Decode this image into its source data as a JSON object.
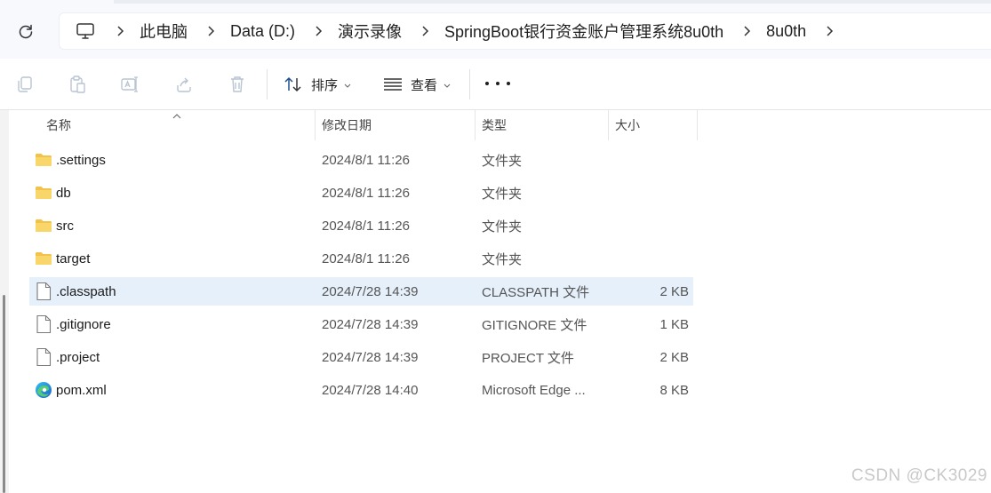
{
  "address": {
    "crumbs": [
      "此电脑",
      "Data (D:)",
      "演示录像",
      "SpringBoot银行资金账户管理系统8u0th",
      "8u0th"
    ]
  },
  "toolbar": {
    "sort_label": "排序",
    "view_label": "查看"
  },
  "columns": {
    "name": "名称",
    "date": "修改日期",
    "type": "类型",
    "size": "大小"
  },
  "files": [
    {
      "name": ".settings",
      "date": "2024/8/1 11:26",
      "type": "文件夹",
      "size": "",
      "icon": "folder-icon"
    },
    {
      "name": "db",
      "date": "2024/8/1 11:26",
      "type": "文件夹",
      "size": "",
      "icon": "folder-icon"
    },
    {
      "name": "src",
      "date": "2024/8/1 11:26",
      "type": "文件夹",
      "size": "",
      "icon": "folder-icon"
    },
    {
      "name": "target",
      "date": "2024/8/1 11:26",
      "type": "文件夹",
      "size": "",
      "icon": "folder-icon"
    },
    {
      "name": ".classpath",
      "date": "2024/7/28 14:39",
      "type": "CLASSPATH 文件",
      "size": "2 KB",
      "icon": "file-icon",
      "selected": true
    },
    {
      "name": ".gitignore",
      "date": "2024/7/28 14:39",
      "type": "GITIGNORE 文件",
      "size": "1 KB",
      "icon": "file-icon"
    },
    {
      "name": ".project",
      "date": "2024/7/28 14:39",
      "type": "PROJECT 文件",
      "size": "2 KB",
      "icon": "file-icon"
    },
    {
      "name": "pom.xml",
      "date": "2024/7/28 14:40",
      "type": "Microsoft Edge ...",
      "size": "8 KB",
      "icon": "edge-icon"
    }
  ],
  "watermark": "CSDN @CK3029",
  "colors": {
    "selected_row": "#e6f0fb",
    "folder": "#f3c24a",
    "accent": "#0067c0"
  }
}
